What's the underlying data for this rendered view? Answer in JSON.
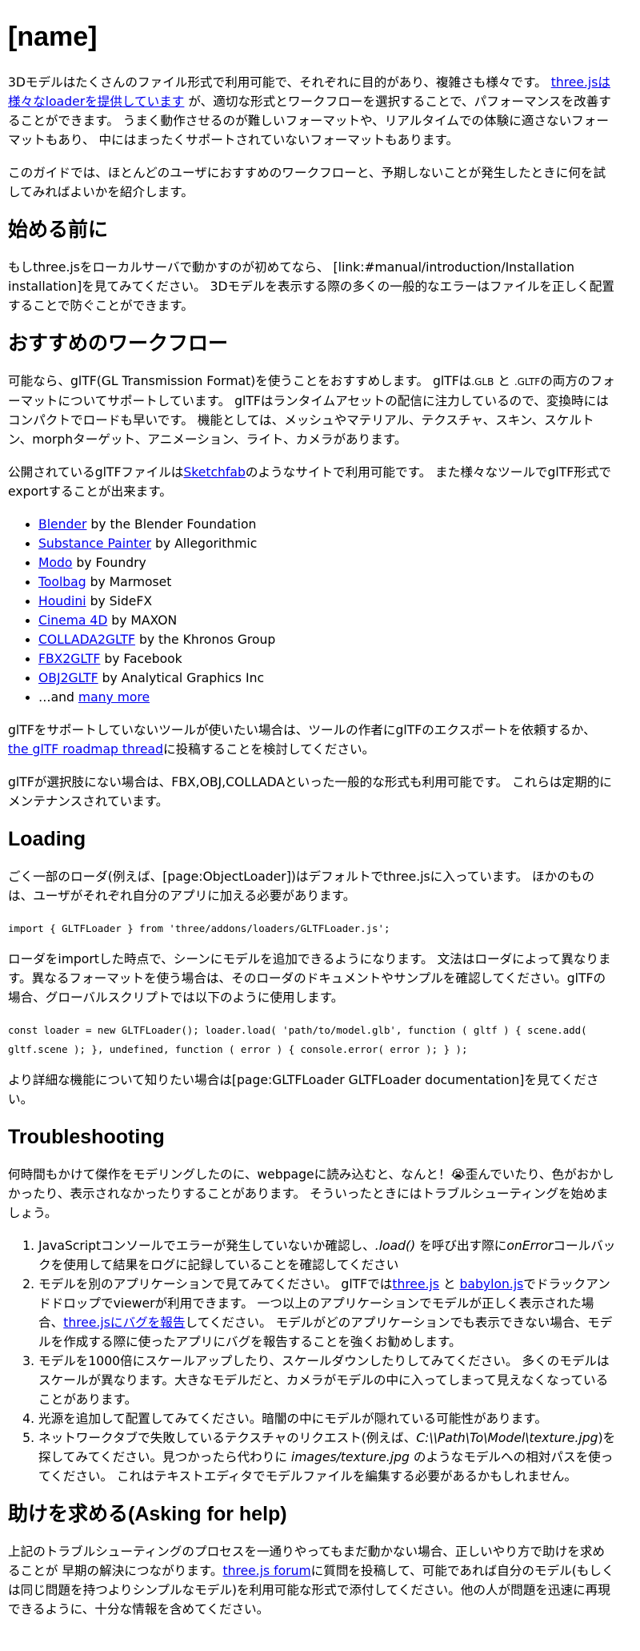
{
  "title": "[name]",
  "intro": {
    "p1_a": "3Dモデルはたくさんのファイル形式で利用可能で、それぞれに目的があり、複雑さも様々です。",
    "p1_link": "three.jsは様々なloaderを提供しています",
    "p1_b": "が、適切な形式とワークフローを選択することで、パフォーマンスを改善することができます。 うまく動作させるのが難しいフォーマットや、リアルタイムでの体験に適さないフォーマットもあり、 中にはまったくサポートされていないフォーマットもあります。",
    "p2": "このガイドでは、ほとんどのユーザにおすすめのワークフローと、予期しないことが発生したときに何を試してみればよいかを紹介します。"
  },
  "before": {
    "heading": "始める前に",
    "p1": "もしthree.jsをローカルサーバで動かすのが初めてなら、 [link:#manual/introduction/Installation installation]を見てみてください。 3Dモデルを表示する際の多くの一般的なエラーはファイルを正しく配置することで防ぐことができます。"
  },
  "workflow": {
    "heading": "おすすめのワークフロー",
    "p1_a": "可能なら、glTF(GL Transmission Format)を使うことをおすすめします。 glTFは",
    "p1_glb": ".GLB",
    "p1_and": " と ",
    "p1_gltf": ".GLTF",
    "p1_b": "の両方のフォーマットについてサポートしています。 glTFはランタイムアセットの配信に注力しているので、変換時にはコンパクトでロードも早いです。 機能としては、メッシュやマテリアル、テクスチャ、スキン、スケルトン、morphターゲット、アニメーション、ライト、カメラがあります。",
    "p2_a": "公開されているglTFファイルは",
    "p2_link": "Sketchfab",
    "p2_b": "のようなサイトで利用可能です。 また様々なツールでglTF形式でexportすることが出来ます。",
    "tools": [
      {
        "name": "Blender",
        "by": " by the Blender Foundation"
      },
      {
        "name": "Substance Painter",
        "by": " by Allegorithmic"
      },
      {
        "name": "Modo",
        "by": " by Foundry"
      },
      {
        "name": "Toolbag",
        "by": " by Marmoset"
      },
      {
        "name": "Houdini",
        "by": " by SideFX"
      },
      {
        "name": "Cinema 4D",
        "by": " by MAXON"
      },
      {
        "name": "COLLADA2GLTF",
        "by": " by the Khronos Group"
      },
      {
        "name": "FBX2GLTF",
        "by": " by Facebook"
      },
      {
        "name": "OBJ2GLTF",
        "by": " by Analytical Graphics Inc"
      }
    ],
    "more_prefix": "…and ",
    "more_link": "many more",
    "p3_a": "glTFをサポートしていないツールが使いたい場合は、ツールの作者にglTFのエクスポートを依頼するか、",
    "p3_link": "the glTF roadmap thread",
    "p3_b": "に投稿することを検討してください。",
    "p4": "glTFが選択肢にない場合は、FBX,OBJ,COLLADAといった一般的な形式も利用可能です。 これらは定期的にメンテナンスされています。"
  },
  "loading": {
    "heading": "Loading",
    "p1": "ごく一部のローダ(例えば、[page:ObjectLoader])はデフォルトでthree.jsに入っています。 ほかのものは、ユーザがそれぞれ自分のアプリに加える必要があります。",
    "code1": "import { GLTFLoader } from 'three/addons/loaders/GLTFLoader.js';",
    "p2": "ローダをimportした時点で、シーンにモデルを追加できるようになります。 文法はローダによって異なります。異なるフォーマットを使う場合は、そのローダのドキュメントやサンプルを確認してください。glTFの場合、グローバルスクリプトでは以下のように使用します。",
    "code2": "const loader = new GLTFLoader(); loader.load( 'path/to/model.glb', function ( gltf ) { scene.add( gltf.scene ); }, undefined, function ( error ) { console.error( error ); } );",
    "p3": "より詳細な機能について知りたい場合は[page:GLTFLoader GLTFLoader documentation]を見てください。"
  },
  "troubleshooting": {
    "heading": "Troubleshooting",
    "p1": "何時間もかけて傑作をモデリングしたのに、webpageに読み込むと、なんと！😭歪んでいたり、色がおかしかったり、表示されなかったりすることがあります。 そういったときにはトラブルシューティングを始めましょう。",
    "item1_a": "JavaScriptコンソールでエラーが発生していないか確認し、",
    "item1_em1": ".load()",
    "item1_b": " を呼び出す際に",
    "item1_em2": "onError",
    "item1_c": "コールバックを使用して結果をログに記録していることを確認してください",
    "item2_a": "モデルを別のアプリケーションで見てみてください。 glTFでは",
    "item2_link1": "three.js",
    "item2_and": " と ",
    "item2_link2": "babylon.js",
    "item2_b": "でドラックアンドドロップでviewerが利用できます。 一つ以上のアプリケーションでモデルが正しく表示された場合、",
    "item2_link3": "three.jsにバグを報告",
    "item2_c": "してください。 モデルがどのアプリケーションでも表示できない場合、モデルを作成する際に使ったアプリにバグを報告することを強くお勧めします。",
    "item3": "モデルを1000倍にスケールアップしたり、スケールダウンしたりしてみてください。 多くのモデルはスケールが異なります。大きなモデルだと、カメラがモデルの中に入ってしまって見えなくなっていることがあります。",
    "item4": "光源を追加して配置してみてください。暗闇の中にモデルが隠れている可能性があります。",
    "item5_a": "ネットワークタブで失敗しているテクスチャのリクエスト(例えば、",
    "item5_em1": "C:\\\\Path\\To\\Model\\texture.jpg",
    "item5_b": ")を探してみてください。見つかったら代わりに ",
    "item5_em2": "images/texture.jpg",
    "item5_c": " のようなモデルへの相対パスを使ってください。 これはテキストエディタでモデルファイルを編集する必要があるかもしれません。"
  },
  "help": {
    "heading": "助けを求める(Asking for help)",
    "p1_a": "上記のトラブルシューティングのプロセスを一通りやってもまだ動かない場合、正しいやり方で助けを求めることが 早期の解決につながります。",
    "p1_link": "three.js forum",
    "p1_b": "に質問を投稿して、可能であれば自分のモデル(もしくは同じ問題を持つよりシンプルなモデル)を利用可能な形式で添付してください。他の人が問題を迅速に再現できるように、十分な情報を含めてください。"
  }
}
